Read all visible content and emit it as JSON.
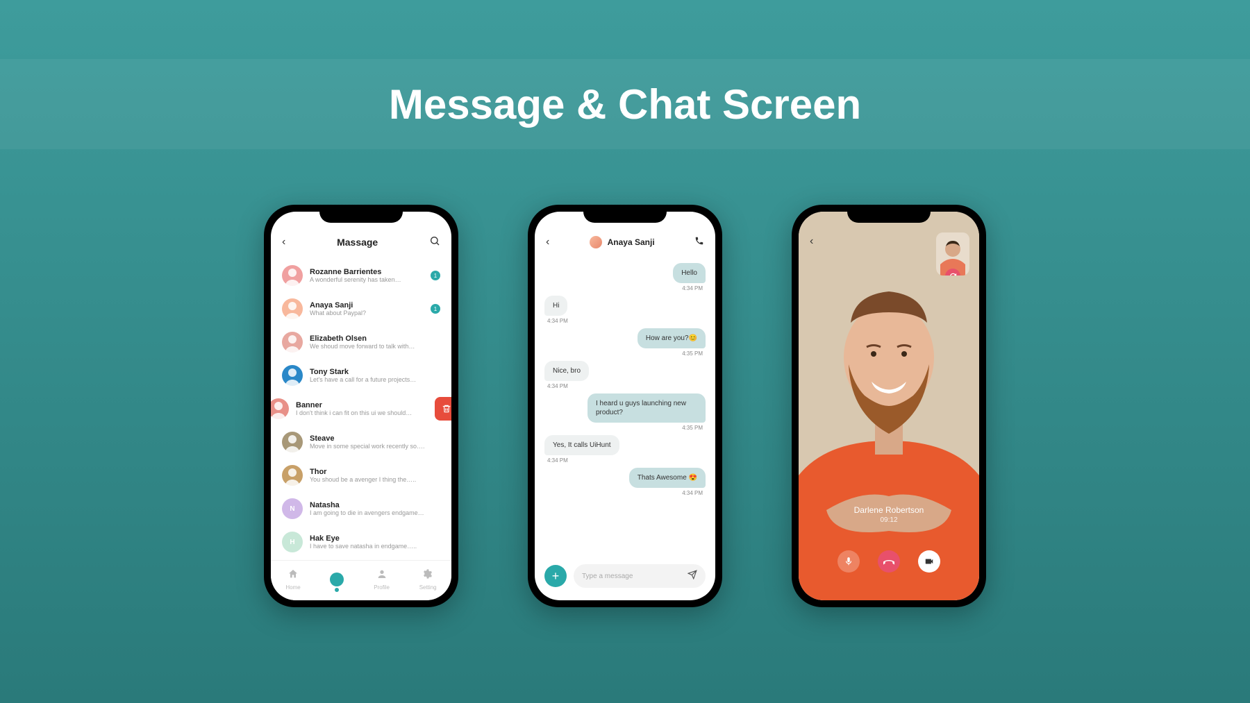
{
  "page_title": "Message & Chat Screen",
  "screen1": {
    "header_title": "Massage",
    "conversations": [
      {
        "name": "Rozanne Barrientes",
        "preview": "A wonderful serenity has taken…",
        "badge": "1",
        "avatar_bg": "#f0a0a0",
        "letter": ""
      },
      {
        "name": "Anaya Sanji",
        "preview": "What about Paypal?",
        "badge": "1",
        "avatar_bg": "#f8b89c",
        "letter": ""
      },
      {
        "name": "Elizabeth Olsen",
        "preview": "We shoud move forward to talk with…",
        "badge": "",
        "avatar_bg": "#e8a8a0",
        "letter": ""
      },
      {
        "name": "Tony Stark",
        "preview": "Let's have a call for a future projects…",
        "badge": "",
        "avatar_bg": "#2a88c8",
        "letter": ""
      },
      {
        "name": "Banner",
        "preview": "I don't think i can fit on this ui we should…",
        "badge": "",
        "avatar_bg": "#e89088",
        "letter": "",
        "swiped": true
      },
      {
        "name": "Steave",
        "preview": "Move in some special work recently so….",
        "badge": "",
        "avatar_bg": "#a89878",
        "letter": ""
      },
      {
        "name": "Thor",
        "preview": "You shoud be a avenger I thing the…..",
        "badge": "",
        "avatar_bg": "#c8a068",
        "letter": ""
      },
      {
        "name": "Natasha",
        "preview": "I am going to die in avengers endgame…",
        "badge": "",
        "avatar_bg": "#d0b8e8",
        "letter": "N"
      },
      {
        "name": "Hak Eye",
        "preview": "I have to save natasha in endgame…..",
        "badge": "",
        "avatar_bg": "#c8e8d8",
        "letter": "H"
      }
    ],
    "bottom_nav": [
      {
        "label": "Home"
      },
      {
        "label": ""
      },
      {
        "label": "Profile"
      },
      {
        "label": "Setting"
      }
    ]
  },
  "screen2": {
    "contact_name": "Anaya Sanji",
    "messages": [
      {
        "side": "right",
        "text": "Hello",
        "time": "4:34 PM"
      },
      {
        "side": "left",
        "text": "Hi",
        "time": "4:34 PM"
      },
      {
        "side": "right",
        "text": "How are you?😊",
        "time": "4:35 PM"
      },
      {
        "side": "left",
        "text": "Nice, bro",
        "time": "4:34 PM"
      },
      {
        "side": "right",
        "text": "I heard u guys launching new product?",
        "time": "4:35 PM"
      },
      {
        "side": "left",
        "text": "Yes, It calls UiHunt",
        "time": "4:34 PM"
      },
      {
        "side": "right",
        "text": "Thats Awesome 😍",
        "time": "4:34 PM"
      }
    ],
    "input_placeholder": "Type a message"
  },
  "screen3": {
    "caller_name": "Darlene Robertson",
    "call_duration": "09:12"
  }
}
